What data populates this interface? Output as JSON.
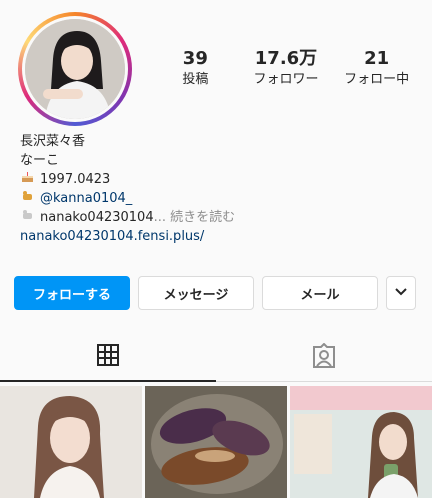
{
  "stats": [
    {
      "value": "39",
      "label": "投稿"
    },
    {
      "value": "17.6万",
      "label": "フォロワー"
    },
    {
      "value": "21",
      "label": "フォロー中"
    }
  ],
  "bio": {
    "name": "長沢菜々香",
    "nickname": "なーこ",
    "birthday_icon": "cake-icon",
    "birthday": "1997.0423",
    "pet_icon": "dog-icon",
    "pet_account": "@kanna0104_",
    "other_icon": "dog-icon",
    "other_account": "nanako04230104",
    "more_text": "... 続きを読む",
    "website": "nanako04230104.fensi.plus/"
  },
  "actions": {
    "follow": "フォローする",
    "message": "メッセージ",
    "email": "メール"
  },
  "tabs": [
    {
      "icon": "grid-icon",
      "active": true
    },
    {
      "icon": "tagged-icon",
      "active": false
    }
  ],
  "colors": {
    "accent": "#0095f6",
    "link": "#00376b"
  }
}
